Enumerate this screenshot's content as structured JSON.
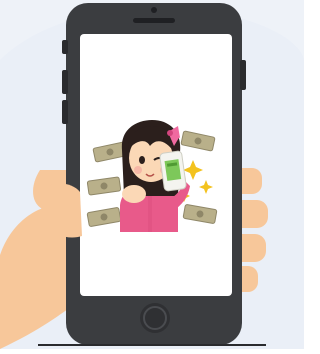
{
  "scene": {
    "subject": "hand-holding-smartphone",
    "colors": {
      "background_blob": "#eef2f8",
      "skin": "#f7c79a",
      "skin_shadow": "#eeae7c",
      "phone_body": "#3b3d40",
      "phone_bezel": "#2a2b2e",
      "screen": "#ffffff",
      "dress": "#e85a8a",
      "hair": "#2b1f1c",
      "bow": "#f06aa0",
      "mini_phone": "#f4f4ef",
      "mini_phone_screen": "#7dc85a",
      "money": "#b9b08a",
      "sparkle": "#f3c21e"
    }
  }
}
